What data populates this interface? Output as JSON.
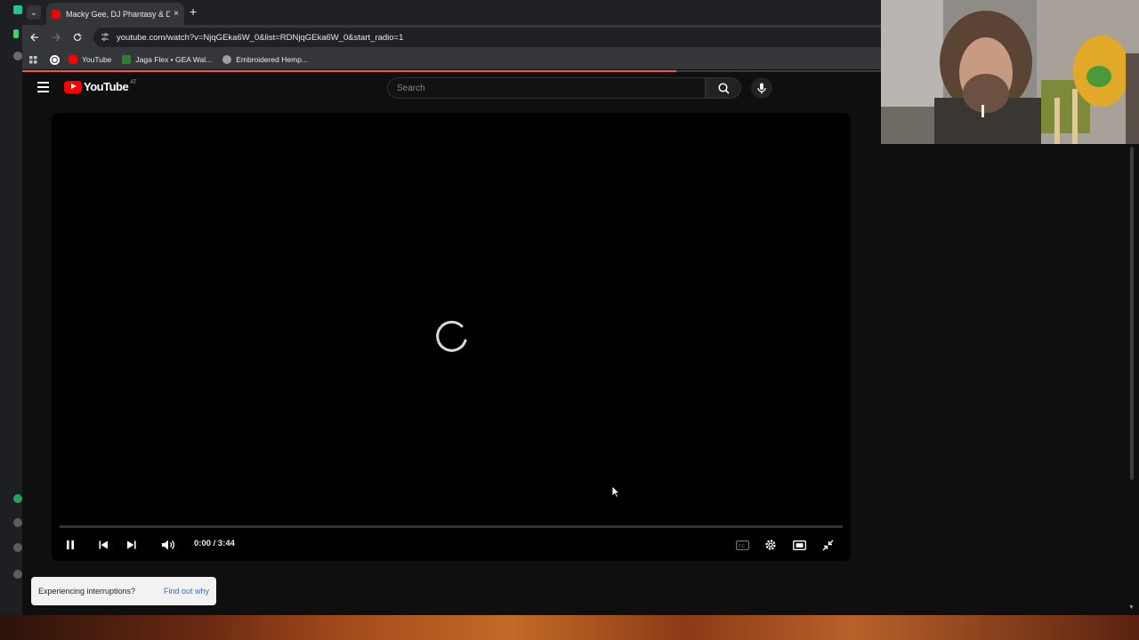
{
  "browser": {
    "tab_title": "Macky Gee, DJ Phantasy & DJ ...",
    "tab_close": "×",
    "new_tab": "+",
    "url": "youtube.com/watch?v=NjqGEka6W_0&list=RDNjqGEka6W_0&start_radio=1",
    "bookmarks": [
      {
        "label": "YouTube",
        "color": "#ff0000"
      },
      {
        "label": "Jaga Flex • GEA Wal...",
        "color": "#2e7d32"
      },
      {
        "label": "Embroidered Hemp...",
        "color": "#9e9e9e"
      }
    ]
  },
  "youtube": {
    "logo_text": "YouTube",
    "country_code": "AT",
    "search_placeholder": "Search"
  },
  "player": {
    "state": "loading",
    "time_display": "0:00 / 3:44",
    "progress_fraction": 0
  },
  "toast": {
    "message": "Experiencing interruptions?",
    "link": "Find out why"
  },
  "colors": {
    "brand_red": "#ff0000",
    "loading_bar": "#ff4e45",
    "toast_link": "#3667d6"
  }
}
